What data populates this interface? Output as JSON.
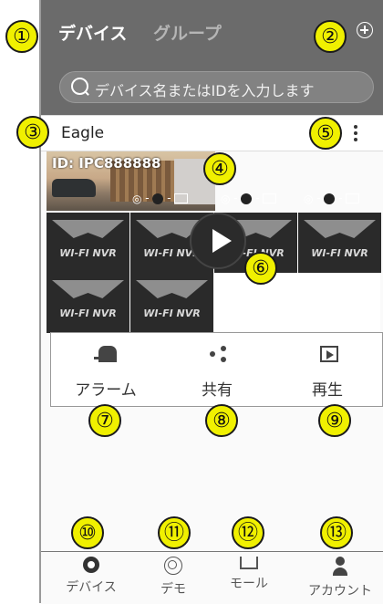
{
  "header": {
    "tab_devices": "デバイス",
    "tab_groups": "グループ",
    "search_placeholder": "デバイス名またはIDを入力します"
  },
  "device": {
    "name": "Eagle",
    "id_label": "ID: IPC888888",
    "channel_label": "WI-FI NVR"
  },
  "actions": [
    {
      "label": "アラーム",
      "icon": "alarm-light-icon"
    },
    {
      "label": "共有",
      "icon": "share-icon"
    },
    {
      "label": "再生",
      "icon": "playback-icon"
    }
  ],
  "tabbar": [
    {
      "label": "デバイス",
      "icon": "device-camera-icon"
    },
    {
      "label": "デモ",
      "icon": "demo-icon"
    },
    {
      "label": "モール",
      "icon": "cart-icon"
    },
    {
      "label": "アカウント",
      "icon": "account-icon"
    }
  ],
  "callouts": [
    "①",
    "②",
    "③",
    "④",
    "⑤",
    "⑥",
    "⑦",
    "⑧",
    "⑨",
    "⑩",
    "⑪",
    "⑫",
    "⑬"
  ],
  "colors": {
    "callout_fill": "#f0f000",
    "header_bg": "#6b6b6b"
  }
}
